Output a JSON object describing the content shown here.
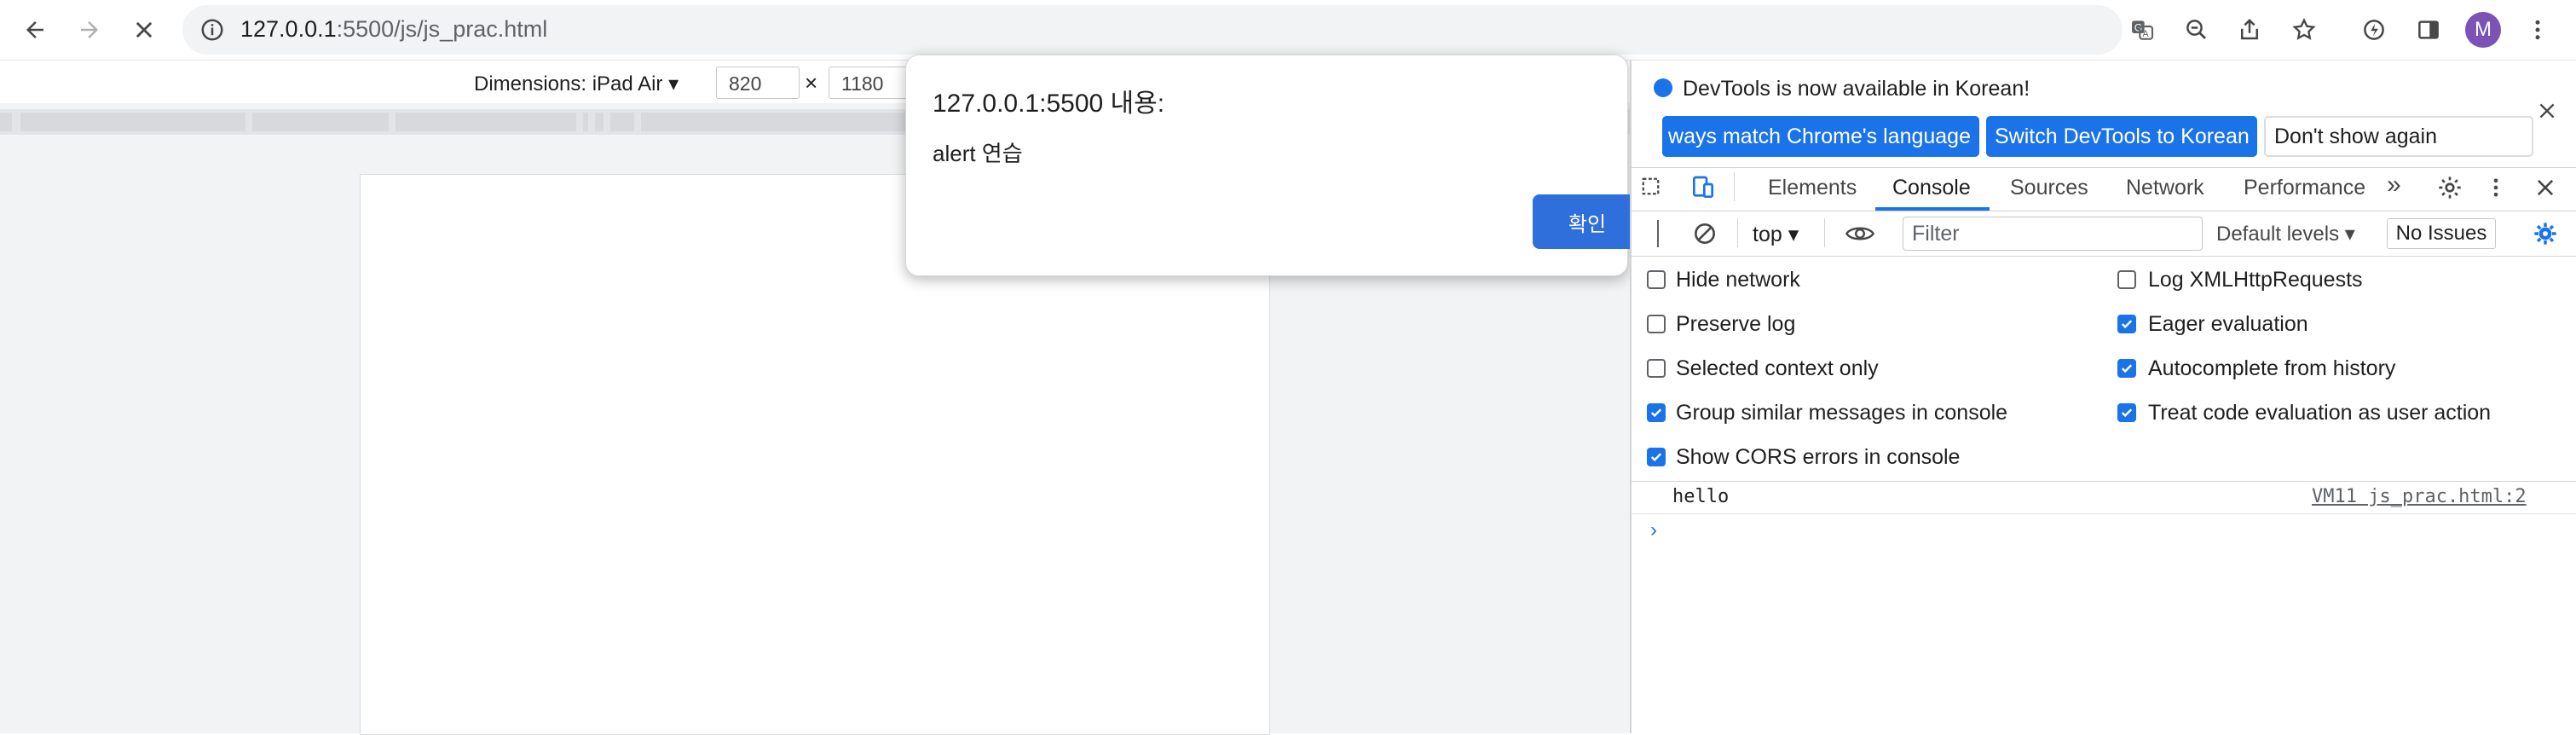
{
  "colors": {
    "accent": "#1a73e8",
    "alert_button": "#2f6fdb",
    "avatar": "#7b53b6"
  },
  "browser": {
    "url_host": "127.0.0.1",
    "url_path": ":5500/js/js_prac.html",
    "avatar_letter": "M",
    "icons": [
      "back-icon",
      "forward-icon",
      "stop-loading-icon",
      "site-info-icon",
      "translate-icon",
      "zoom-icon",
      "share-icon",
      "bookmark-star-icon",
      "extension-icon",
      "side-panel-icon",
      "avatar",
      "more-menu-icon"
    ]
  },
  "device_toolbar": {
    "dimensions_label": "Dimensions: iPad Air ▾",
    "width": "820",
    "height": "1180",
    "times": "×"
  },
  "alert": {
    "title": "127.0.0.1:5500 내용:",
    "message": "alert 연습",
    "ok_label": "확인"
  },
  "devtools": {
    "banner": {
      "text": "DevTools is now available in Korean!",
      "btn_match": "ways match Chrome's language",
      "btn_switch": "Switch DevTools to Korean",
      "btn_dismiss": "Don't show again"
    },
    "tabs": [
      "Elements",
      "Console",
      "Sources",
      "Network",
      "Performance"
    ],
    "more_tabs": "»",
    "console_toolbar": {
      "context": "top ▾",
      "filter_placeholder": "Filter",
      "levels": "Default levels ▾",
      "issues": "No Issues"
    },
    "settings": {
      "left": [
        {
          "label": "Hide network",
          "checked": false
        },
        {
          "label": "Preserve log",
          "checked": false
        },
        {
          "label": "Selected context only",
          "checked": false
        },
        {
          "label": "Group similar messages in console",
          "checked": true
        },
        {
          "label": "Show CORS errors in console",
          "checked": true
        }
      ],
      "right": [
        {
          "label": "Log XMLHttpRequests",
          "checked": false
        },
        {
          "label": "Eager evaluation",
          "checked": true
        },
        {
          "label": "Autocomplete from history",
          "checked": true
        },
        {
          "label": "Treat code evaluation as user action",
          "checked": true
        }
      ]
    },
    "log": {
      "message": "hello",
      "source": "VM11 js_prac.html:2"
    },
    "prompt": "›"
  }
}
